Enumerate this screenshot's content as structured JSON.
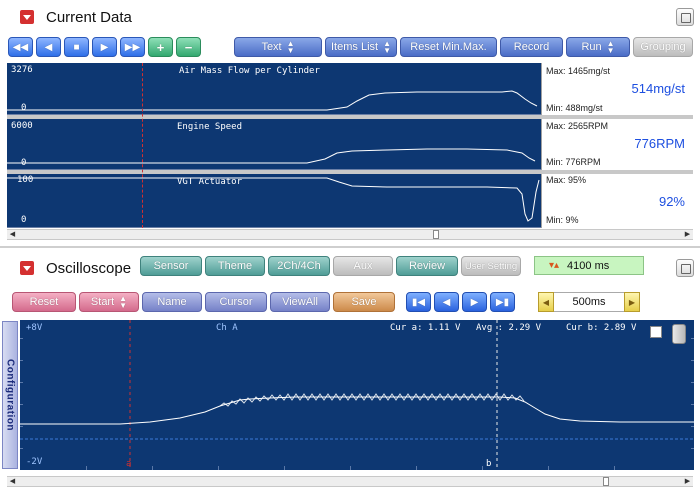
{
  "current_data": {
    "title": "Current Data",
    "toolbar": {
      "text_label": "Text",
      "items_list_label": "Items List",
      "reset_minmax_label": "Reset Min.Max.",
      "record_label": "Record",
      "run_label": "Run",
      "grouping_label": "Grouping"
    },
    "graphs": [
      {
        "name": "Air Mass Flow per Cylinder",
        "scale_max": "3276",
        "scale_min": "0",
        "max_text": "Max: 1465mg/st",
        "min_text": "Min:  488mg/st",
        "current_value": "514mg/st"
      },
      {
        "name": "Engine Speed",
        "scale_max": "6000",
        "scale_min": "0",
        "max_text": "Max: 2565RPM",
        "min_text": "Min:  776RPM",
        "current_value": "776RPM"
      },
      {
        "name": "VGT Actuator",
        "scale_max": "100",
        "scale_min": "0",
        "max_text": "Max:  95%",
        "min_text": "Min:   9%",
        "current_value": "92%"
      }
    ]
  },
  "oscilloscope": {
    "title": "Oscilloscope",
    "tabs": {
      "sensor": "Sensor",
      "theme": "Theme",
      "channels": "2Ch/4Ch",
      "aux": "Aux",
      "review": "Review",
      "user_setting": "User Setting"
    },
    "time_display": "4100 ms",
    "buttons": {
      "reset": "Reset",
      "start": "Start",
      "name": "Name",
      "cursor": "Cursor",
      "view_all": "ViewAll",
      "save": "Save"
    },
    "time_div": "500ms",
    "config_label": "Configuration",
    "screen": {
      "top_volt": "+8V",
      "bottom_volt": "-2V",
      "channel": "Ch A",
      "cur_a": "Cur a: 1.11 V",
      "avg": "Avg :  2.29 V",
      "cur_b": "Cur b: 2.89 V",
      "marker_a": "a",
      "marker_b": "b"
    }
  },
  "colors": {
    "graph_bg": "#0d3772",
    "trace": "#ffffff",
    "value_text": "#1d4fe0",
    "cursor_a": "#d03030",
    "collapse_red": "#d43030"
  }
}
